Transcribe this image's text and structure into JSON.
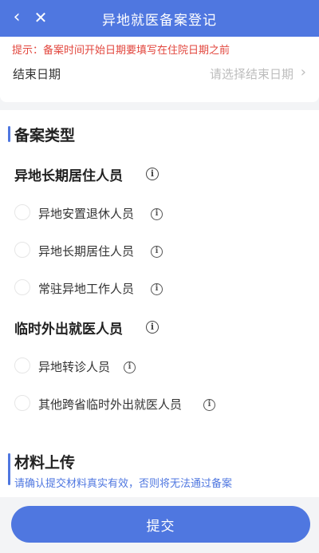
{
  "header": {
    "title": "异地就医备案登记",
    "back_glyph": "‹",
    "close_glyph": "✕"
  },
  "tip": "提示：备案时间开始日期要填写在住院日期之前",
  "end_date": {
    "label": "结束日期",
    "placeholder": "请选择结束日期",
    "chevron": "›"
  },
  "filing_type": {
    "title": "备案类型",
    "groups": [
      {
        "title": "异地长期居住人员",
        "options": [
          "异地安置退休人员",
          "异地长期居住人员",
          "常驻异地工作人员"
        ]
      },
      {
        "title": "临时外出就医人员",
        "options": [
          "异地转诊人员",
          "其他跨省临时外出就医人员"
        ]
      }
    ]
  },
  "upload": {
    "title": "材料上传",
    "note": "请确认提交材料真实有效，否则将无法通过备案"
  },
  "info_glyph": "i",
  "submit_label": "提交",
  "colors": {
    "primary": "#4f77e0",
    "tip_red": "#e2463d",
    "background": "#f3f4f6"
  }
}
